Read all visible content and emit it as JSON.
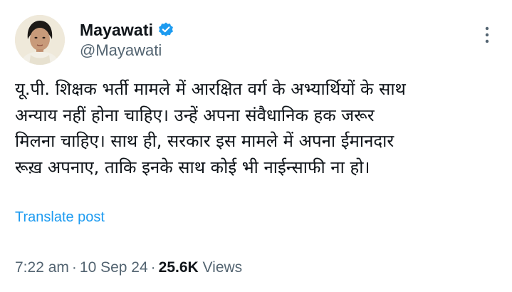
{
  "author": {
    "display_name": "Mayawati",
    "handle": "@Mayawati",
    "verified_icon": "verified-badge-icon",
    "accent_color": "#1d9bf0"
  },
  "post": {
    "lines": [
      "यू.पी. शिक्षक भर्ती मामले में आरक्षित वर्ग के अभ्यार्थियों के साथ",
      "अन्याय नहीं होना चाहिए। उन्हें अपना संवैधानिक हक जरूर",
      "मिलना चाहिए। साथ ही, सरकार इस मामले में अपना ईमानदार",
      "रूख़ अपनाए, ताकि इनके साथ कोई भी नाईन्साफी ना हो।"
    ],
    "translate_label": "Translate post"
  },
  "meta": {
    "time": "7:22 am",
    "separator": "·",
    "date": "10 Sep 24",
    "views_count": "25.6K",
    "views_label": "Views"
  },
  "icons": {
    "more": "more-options-icon"
  }
}
